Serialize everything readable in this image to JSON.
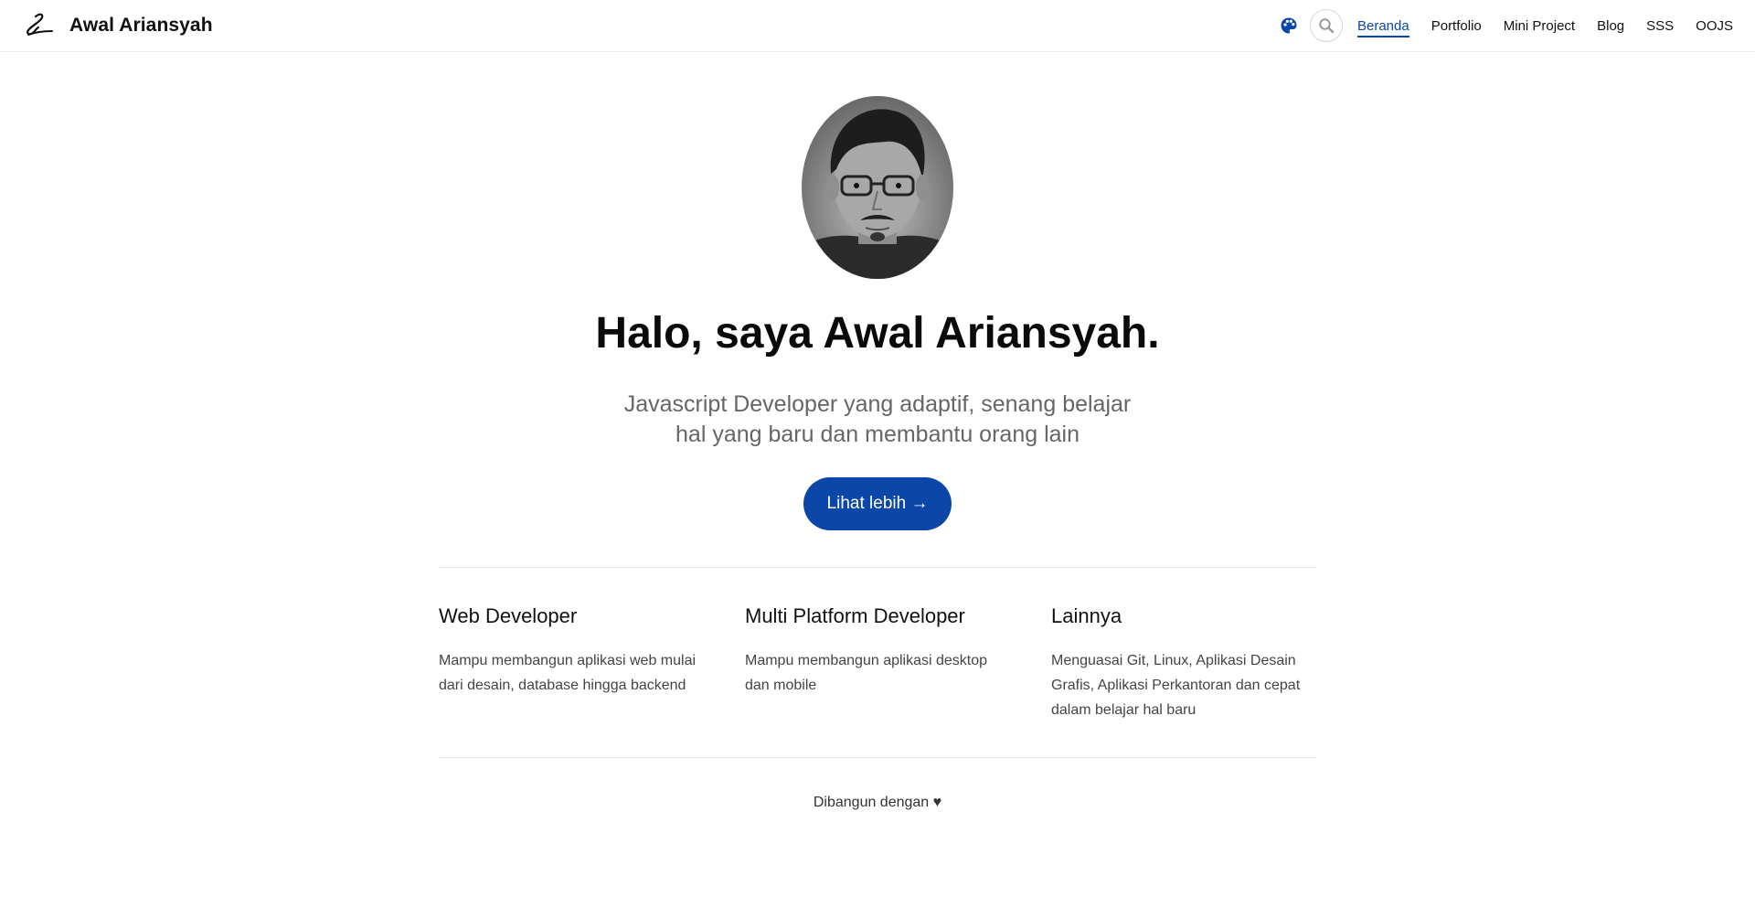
{
  "brand": {
    "name": "Awal Ariansyah"
  },
  "nav": {
    "items": [
      {
        "label": "Beranda",
        "active": true
      },
      {
        "label": "Portfolio"
      },
      {
        "label": "Mini Project"
      },
      {
        "label": "Blog"
      },
      {
        "label": "SSS"
      },
      {
        "label": "OOJS"
      }
    ]
  },
  "icons": {
    "brand": "signature-logo-icon",
    "theme": "palette-icon",
    "search": "search-icon"
  },
  "colors": {
    "accent": "#0a47a9"
  },
  "hero": {
    "title": "Halo, saya Awal Ariansyah.",
    "subtitle": "Javascript Developer yang adaptif, senang belajar hal yang baru dan membantu orang lain",
    "cta": "Lihat lebih →"
  },
  "features": [
    {
      "title": "Web Developer",
      "desc": "Mampu membangun aplikasi web mulai dari desain, database hingga backend"
    },
    {
      "title": "Multi Platform Developer",
      "desc": "Mampu membangun aplikasi desktop dan mobile"
    },
    {
      "title": "Lainnya",
      "desc": "Menguasai Git, Linux, Aplikasi Desain Grafis, Aplikasi Perkantoran dan cepat dalam belajar hal baru"
    }
  ],
  "footer": {
    "text": "Dibangun dengan ♥"
  }
}
